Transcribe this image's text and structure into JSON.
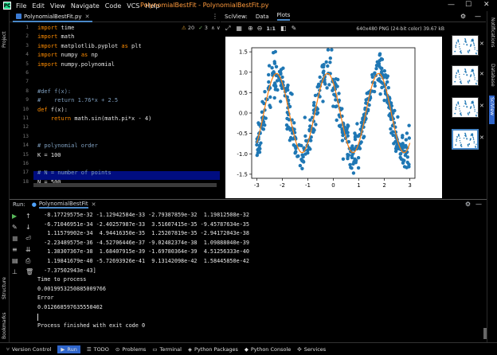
{
  "app": {
    "title": "PolynomialBestFit - PolynomialBestFit.py"
  },
  "menu": [
    "File",
    "Edit",
    "View",
    "Navigate",
    "Code",
    "VCS",
    "Help"
  ],
  "left_strip": {
    "project": "Project",
    "structure": "Structure",
    "bookmarks": "Bookmarks"
  },
  "right_strip": {
    "notifications": "Notifications",
    "database": "Database",
    "sciview": "SciView"
  },
  "editor": {
    "tab_label": "PolynomialBestFit.py",
    "inspections": {
      "warnings": "20",
      "weak": "3"
    },
    "lines": [
      {
        "n": "1",
        "text": "import time"
      },
      {
        "n": "2",
        "text": "import math"
      },
      {
        "n": "3",
        "text": "import matplotlib.pyplot as plt"
      },
      {
        "n": "4",
        "text": "import numpy as np"
      },
      {
        "n": "5",
        "text": "import numpy.polynomial"
      },
      {
        "n": "6",
        "text": ""
      },
      {
        "n": "7",
        "text": ""
      },
      {
        "n": "8",
        "text": "#def f(x):"
      },
      {
        "n": "9",
        "text": "#    return 1.76*x + 2.5"
      },
      {
        "n": "10",
        "text": "def f(x):"
      },
      {
        "n": "11",
        "text": "    return math.sin(math.pi*x - 4)"
      },
      {
        "n": "12",
        "text": ""
      },
      {
        "n": "13",
        "text": ""
      },
      {
        "n": "14",
        "text": "# polynomial order"
      },
      {
        "n": "15",
        "text": "K = 100"
      },
      {
        "n": "16",
        "text": ""
      },
      {
        "n": "17",
        "text": "# N = number of points"
      },
      {
        "n": "18",
        "text": "N = 500"
      }
    ]
  },
  "sciview": {
    "header": "SciView:",
    "tab_data": "Data",
    "tab_plots": "Plots",
    "toolbar_zoom": "1:1",
    "image_info": "640x480 PNG (24-bit color) 39.67 kB",
    "close": "✕"
  },
  "chart_data": {
    "type": "scatter",
    "title": "",
    "xlabel": "",
    "ylabel": "",
    "xlim": [
      -3.2,
      3.2
    ],
    "ylim": [
      -1.6,
      1.6
    ],
    "xticks": [
      "-3",
      "-2",
      "-1",
      "0",
      "1",
      "2",
      "3"
    ],
    "yticks": [
      "1.5",
      "1.0",
      "0.5",
      "0.0",
      "-0.5",
      "-1.0",
      "-1.5"
    ],
    "series": [
      {
        "type": "scatter",
        "color": "#1f77b4",
        "n": 500,
        "x_range": [
          -3,
          3
        ],
        "function": "sin(pi*x - 4) + noise",
        "noise": 0.25
      },
      {
        "type": "line",
        "color": "#ff7f0e",
        "function": "polynomial fit, order 100"
      }
    ]
  },
  "run": {
    "label": "Run:",
    "config": "PolynomialBestFit",
    "close": "✕",
    "output": [
      "  -8.17729575e-32 -1.12942584e-33 -2.79387859e-32  1.19812508e-32",
      "  -6.71046951e-34 -2.40257987e-33  3.51607415e-35 -9.45787634e-35",
      "   1.11579902e-34  4.94416350e-35  1.25207819e-35 -2.94172043e-38",
      "  -2.23489575e-36 -4.52706446e-37 -9.02482374e-38  1.09888040e-39",
      "   1.38307367e-38  1.68407915e-39 -1.69780364e-39  4.51256333e-40",
      "   1.19841679e-40 -5.72693926e-41  9.13142098e-42  1.58445850e-42",
      "  -7.37502943e-43]",
      "Time to process",
      "0.0019953250885009766",
      "Error",
      "0.012668597635550402",
      "",
      "Process finished with exit code 0"
    ]
  },
  "statusbar": [
    {
      "name": "version-control",
      "label": "Version Control",
      "icon": "⑂"
    },
    {
      "name": "run",
      "label": "Run",
      "icon": "▶",
      "active": true
    },
    {
      "name": "todo",
      "label": "TODO",
      "icon": "☰"
    },
    {
      "name": "problems",
      "label": "Problems",
      "icon": "⊙"
    },
    {
      "name": "terminal",
      "label": "Terminal",
      "icon": "▭"
    },
    {
      "name": "python-packages",
      "label": "Python Packages",
      "icon": "◈"
    },
    {
      "name": "python-console",
      "label": "Python Console",
      "icon": "◆"
    },
    {
      "name": "services",
      "label": "Services",
      "icon": "✣"
    }
  ],
  "colors": {
    "accent": "#2f65ca",
    "highlight_line": "#000d80",
    "keyword": "#ff8c00",
    "title": "#ff9a3c",
    "scatter": "#1f77b4",
    "fit": "#ff7f0e"
  }
}
